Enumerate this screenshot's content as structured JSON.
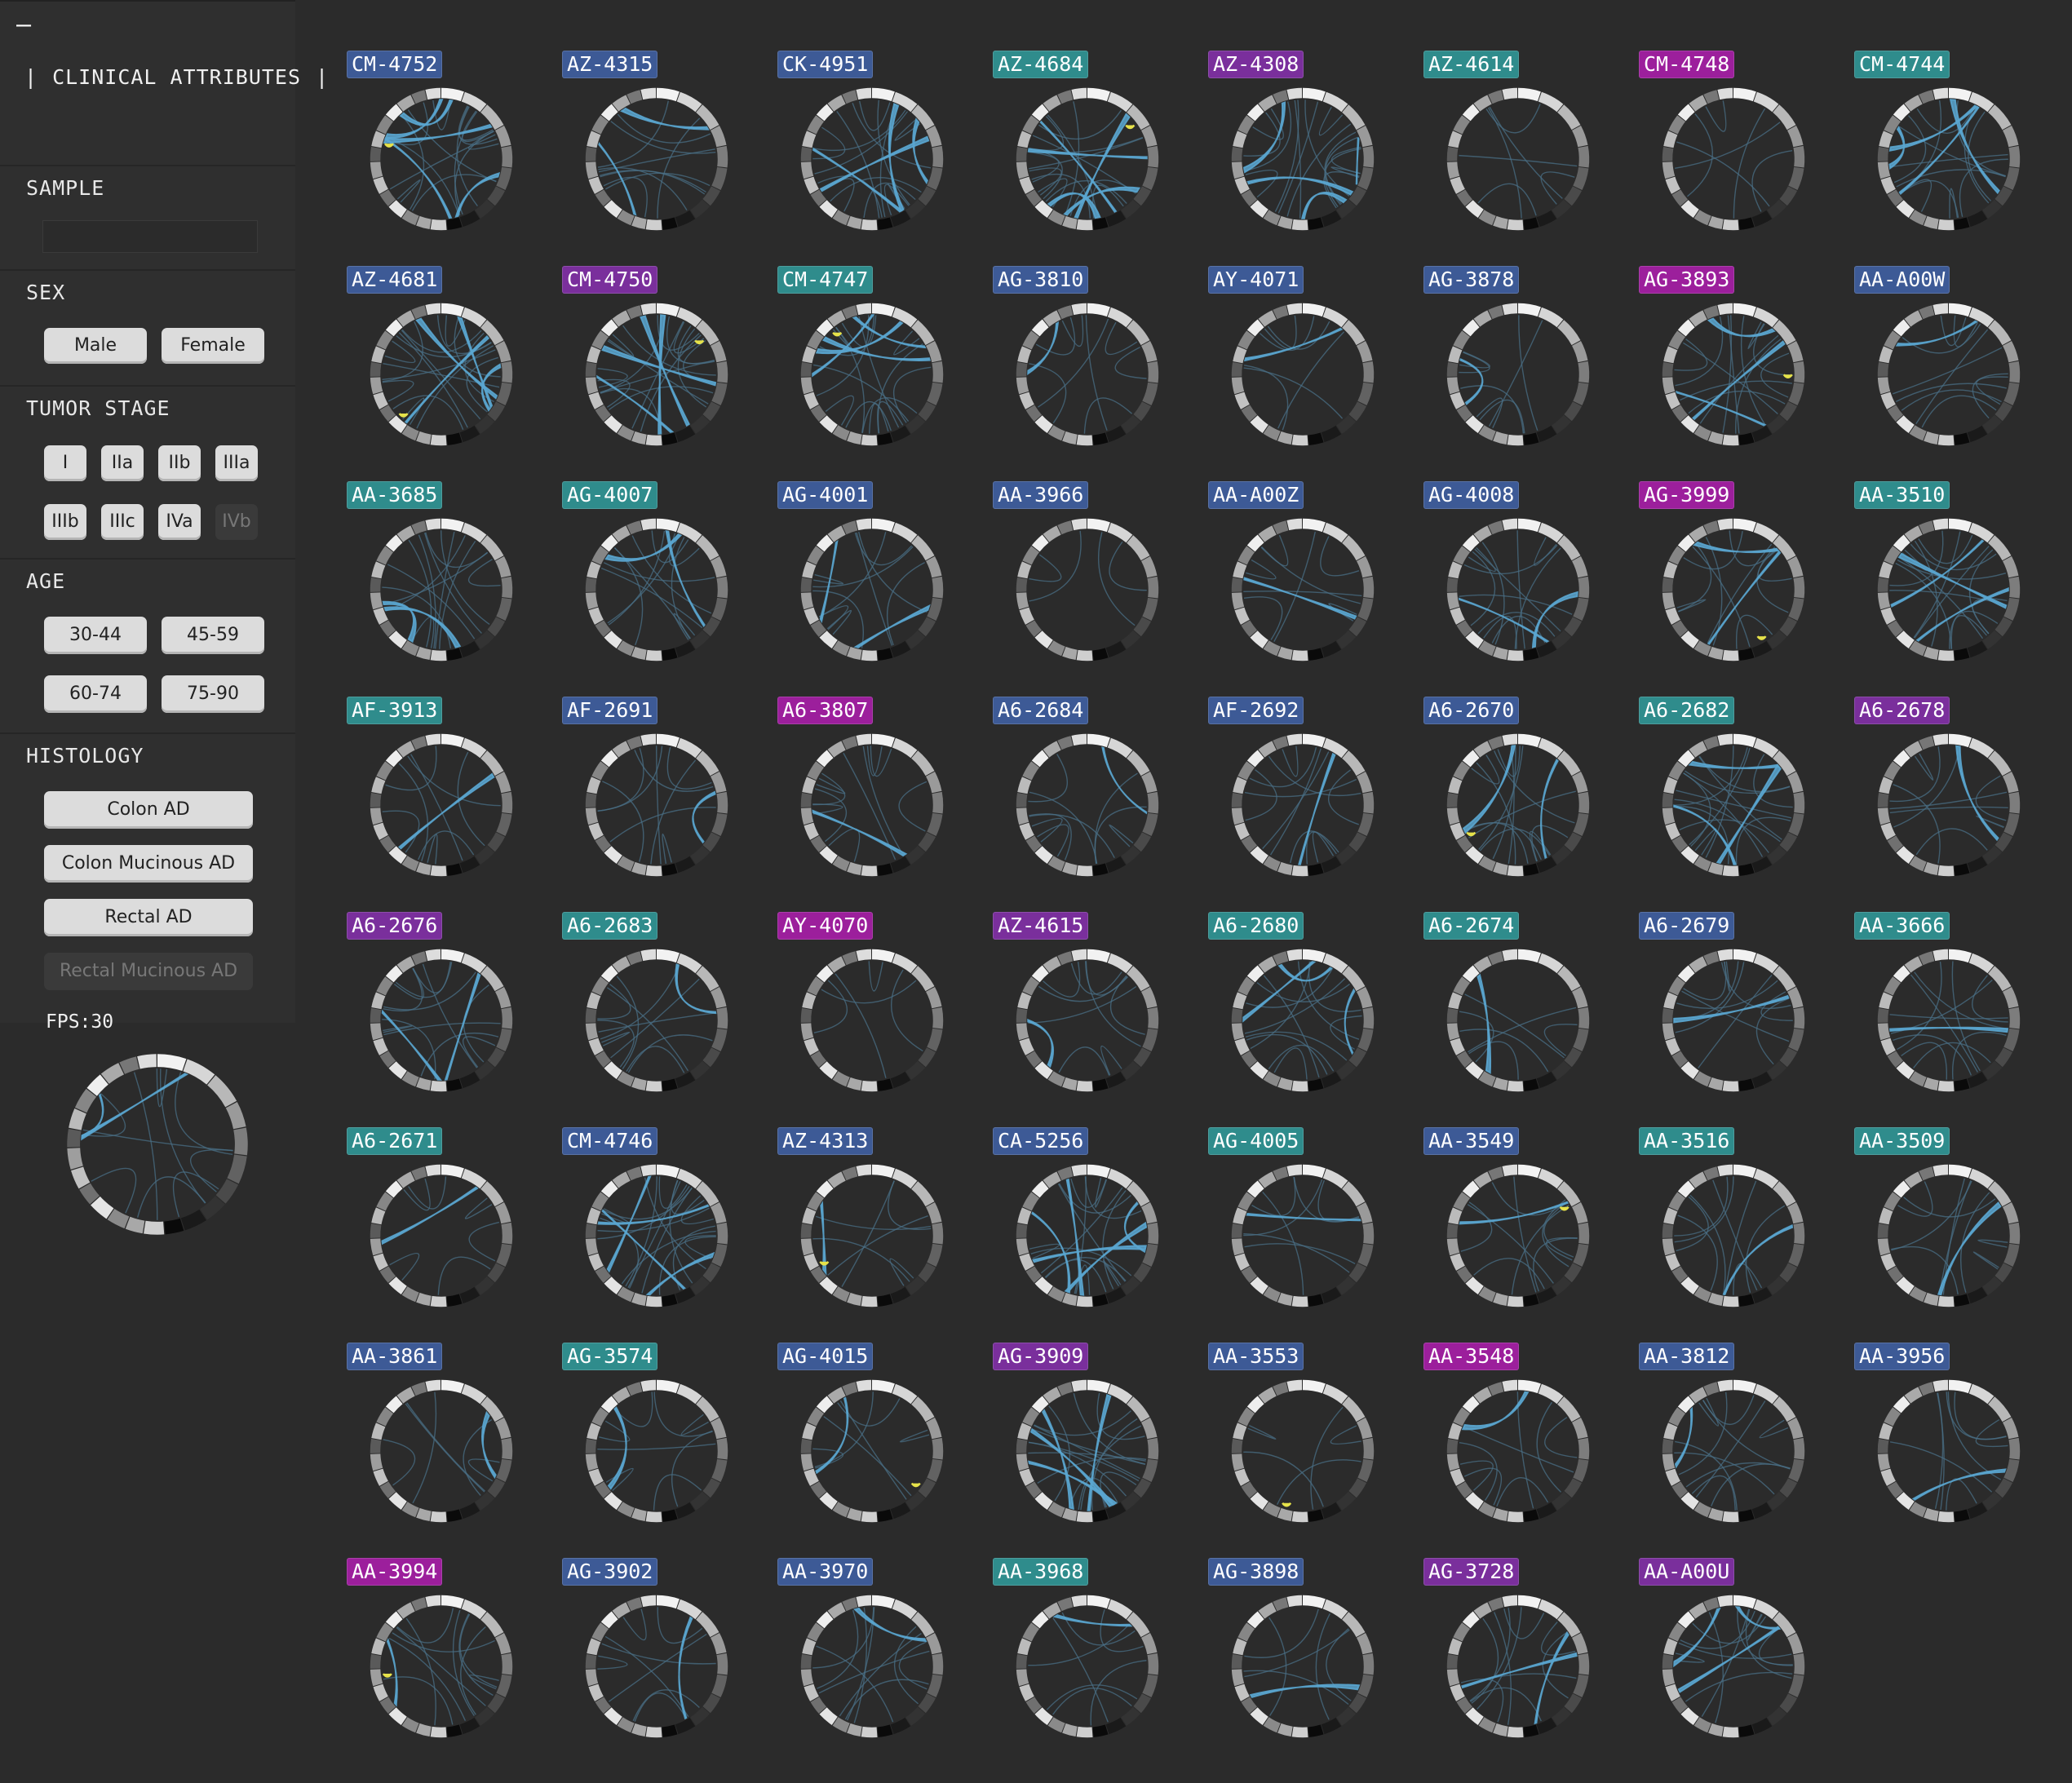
{
  "sidebar": {
    "collapse_label": "–",
    "header": {
      "bar_left": "|",
      "title": "CLINICAL ATTRIBUTES",
      "bar_right": "|"
    },
    "sample": {
      "label": "SAMPLE",
      "value": "",
      "placeholder": ""
    },
    "sex": {
      "label": "SEX",
      "options": [
        "Male",
        "Female"
      ]
    },
    "tumor_stage": {
      "label": "TUMOR STAGE",
      "options": [
        "I",
        "IIa",
        "IIb",
        "IIIa",
        "IIIb",
        "IIIc",
        "IVa",
        "IVb"
      ],
      "disabled": [
        "IVb"
      ]
    },
    "age": {
      "label": "AGE",
      "options": [
        "30-44",
        "45-59",
        "60-74",
        "75-90"
      ]
    },
    "histology": {
      "label": "HISTOLOGY",
      "options": [
        "Colon AD",
        "Colon Mucinous AD",
        "Rectal AD",
        "Rectal Mucinous AD"
      ],
      "disabled": [
        "Rectal Mucinous AD"
      ]
    },
    "fps_label": "FPS:30"
  },
  "colors": {
    "background": "#2b2b2b",
    "panel": "#2f2f2f",
    "tag_blue": "#3d5a96",
    "tag_teal": "#2f8c8c",
    "tag_purple": "#7a2f9c",
    "tag_magenta": "#9c1f9c",
    "link_blue": "#5aa6d0",
    "link_yellow": "#e6e24a",
    "link_faint": "#4a6f86"
  },
  "samples": [
    {
      "id": "CM-4752",
      "tag": "blue",
      "level": 5,
      "yellow": 1
    },
    {
      "id": "AZ-4315",
      "tag": "blue",
      "level": 2,
      "yellow": 0
    },
    {
      "id": "CK-4951",
      "tag": "blue",
      "level": 4,
      "yellow": 0
    },
    {
      "id": "AZ-4684",
      "tag": "teal",
      "level": 5,
      "yellow": 1
    },
    {
      "id": "AZ-4308",
      "tag": "purple",
      "level": 4,
      "yellow": 0
    },
    {
      "id": "AZ-4614",
      "tag": "teal",
      "level": 0,
      "yellow": 0
    },
    {
      "id": "CM-4748",
      "tag": "magenta",
      "level": 0,
      "yellow": 0
    },
    {
      "id": "CM-4744",
      "tag": "teal",
      "level": 4,
      "yellow": 0
    },
    {
      "id": "AZ-4681",
      "tag": "blue",
      "level": 4,
      "yellow": 1
    },
    {
      "id": "CM-4750",
      "tag": "purple",
      "level": 4,
      "yellow": 1
    },
    {
      "id": "CM-4747",
      "tag": "teal",
      "level": 4,
      "yellow": 1
    },
    {
      "id": "AG-3810",
      "tag": "blue",
      "level": 1,
      "yellow": 0
    },
    {
      "id": "AY-4071",
      "tag": "blue",
      "level": 1,
      "yellow": 0
    },
    {
      "id": "AG-3878",
      "tag": "blue",
      "level": 1,
      "yellow": 0
    },
    {
      "id": "AG-3893",
      "tag": "magenta",
      "level": 3,
      "yellow": 1
    },
    {
      "id": "AA-A00W",
      "tag": "blue",
      "level": 1,
      "yellow": 0
    },
    {
      "id": "AA-3685",
      "tag": "teal",
      "level": 2,
      "yellow": 0
    },
    {
      "id": "AG-4007",
      "tag": "teal",
      "level": 2,
      "yellow": 0
    },
    {
      "id": "AG-4001",
      "tag": "blue",
      "level": 2,
      "yellow": 0
    },
    {
      "id": "AA-3966",
      "tag": "blue",
      "level": 0,
      "yellow": 0
    },
    {
      "id": "AA-A00Z",
      "tag": "blue",
      "level": 1,
      "yellow": 0
    },
    {
      "id": "AG-4008",
      "tag": "blue",
      "level": 2,
      "yellow": 0
    },
    {
      "id": "AG-3999",
      "tag": "magenta",
      "level": 2,
      "yellow": 1
    },
    {
      "id": "AA-3510",
      "tag": "teal",
      "level": 3,
      "yellow": 0
    },
    {
      "id": "AF-3913",
      "tag": "teal",
      "level": 1,
      "yellow": 0
    },
    {
      "id": "AF-2691",
      "tag": "blue",
      "level": 1,
      "yellow": 0
    },
    {
      "id": "A6-3807",
      "tag": "magenta",
      "level": 1,
      "yellow": 0
    },
    {
      "id": "A6-2684",
      "tag": "blue",
      "level": 1,
      "yellow": 0
    },
    {
      "id": "AF-2692",
      "tag": "blue",
      "level": 1,
      "yellow": 0
    },
    {
      "id": "A6-2670",
      "tag": "blue",
      "level": 2,
      "yellow": 1
    },
    {
      "id": "A6-2682",
      "tag": "teal",
      "level": 3,
      "yellow": 0
    },
    {
      "id": "A6-2678",
      "tag": "purple",
      "level": 1,
      "yellow": 0
    },
    {
      "id": "A6-2676",
      "tag": "purple",
      "level": 2,
      "yellow": 0
    },
    {
      "id": "A6-2683",
      "tag": "teal",
      "level": 1,
      "yellow": 0
    },
    {
      "id": "AY-4070",
      "tag": "magenta",
      "level": 0,
      "yellow": 0
    },
    {
      "id": "AZ-4615",
      "tag": "purple",
      "level": 1,
      "yellow": 0
    },
    {
      "id": "A6-2680",
      "tag": "teal",
      "level": 3,
      "yellow": 0
    },
    {
      "id": "A6-2674",
      "tag": "teal",
      "level": 1,
      "yellow": 0
    },
    {
      "id": "A6-2679",
      "tag": "blue",
      "level": 1,
      "yellow": 0
    },
    {
      "id": "AA-3666",
      "tag": "teal",
      "level": 1,
      "yellow": 0
    },
    {
      "id": "A6-2671",
      "tag": "teal",
      "level": 1,
      "yellow": 0
    },
    {
      "id": "CM-4746",
      "tag": "blue",
      "level": 4,
      "yellow": 0
    },
    {
      "id": "AZ-4313",
      "tag": "blue",
      "level": 1,
      "yellow": 1
    },
    {
      "id": "CA-5256",
      "tag": "blue",
      "level": 5,
      "yellow": 0
    },
    {
      "id": "AG-4005",
      "tag": "teal",
      "level": 1,
      "yellow": 0
    },
    {
      "id": "AA-3549",
      "tag": "blue",
      "level": 1,
      "yellow": 1
    },
    {
      "id": "AA-3516",
      "tag": "teal",
      "level": 1,
      "yellow": 0
    },
    {
      "id": "AA-3509",
      "tag": "teal",
      "level": 1,
      "yellow": 0
    },
    {
      "id": "AA-3861",
      "tag": "blue",
      "level": 1,
      "yellow": 0
    },
    {
      "id": "AG-3574",
      "tag": "teal",
      "level": 1,
      "yellow": 0
    },
    {
      "id": "AG-4015",
      "tag": "blue",
      "level": 1,
      "yellow": 1
    },
    {
      "id": "AG-3909",
      "tag": "purple",
      "level": 4,
      "yellow": 0
    },
    {
      "id": "AA-3553",
      "tag": "blue",
      "level": 0,
      "yellow": 1
    },
    {
      "id": "AA-3548",
      "tag": "magenta",
      "level": 1,
      "yellow": 0
    },
    {
      "id": "AA-3812",
      "tag": "blue",
      "level": 1,
      "yellow": 0
    },
    {
      "id": "AA-3956",
      "tag": "blue",
      "level": 1,
      "yellow": 0
    },
    {
      "id": "AA-3994",
      "tag": "magenta",
      "level": 1,
      "yellow": 1
    },
    {
      "id": "AG-3902",
      "tag": "blue",
      "level": 1,
      "yellow": 0
    },
    {
      "id": "AA-3970",
      "tag": "blue",
      "level": 1,
      "yellow": 0
    },
    {
      "id": "AA-3968",
      "tag": "teal",
      "level": 1,
      "yellow": 0
    },
    {
      "id": "AG-3898",
      "tag": "blue",
      "level": 1,
      "yellow": 0
    },
    {
      "id": "AG-3728",
      "tag": "purple",
      "level": 2,
      "yellow": 0
    },
    {
      "id": "AA-A00U",
      "tag": "purple",
      "level": 3,
      "yellow": 0
    }
  ]
}
